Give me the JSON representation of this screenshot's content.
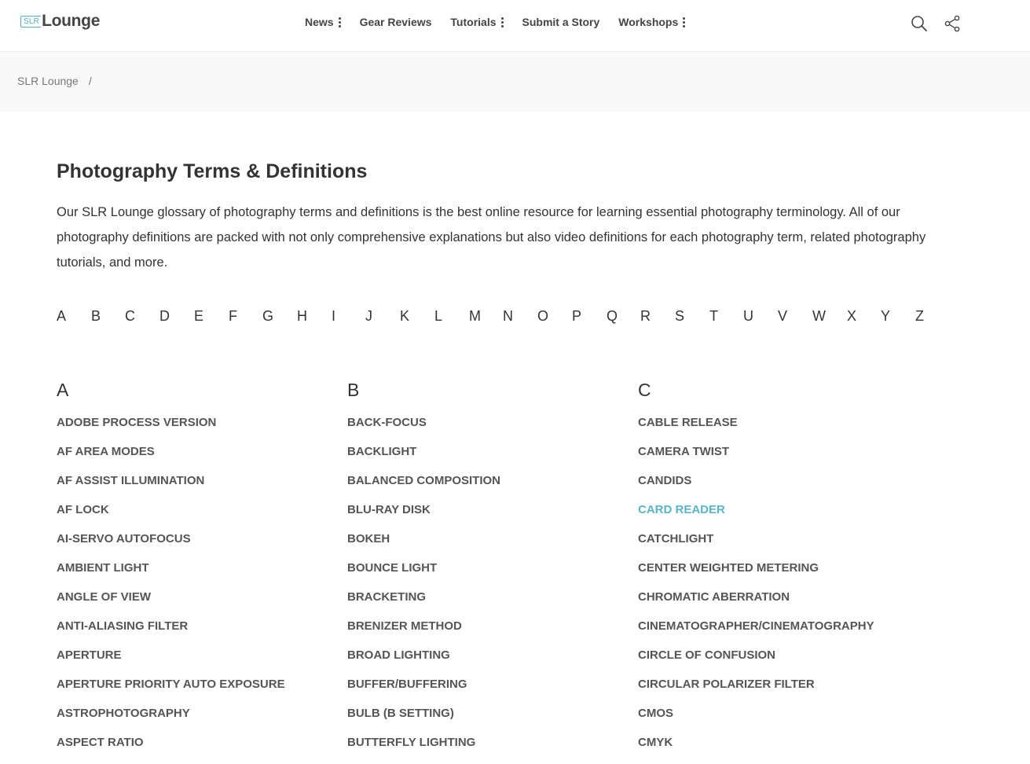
{
  "header": {
    "logo_box": "SLR",
    "logo_text": "Lounge",
    "nav": [
      {
        "label": "News",
        "has_menu": true
      },
      {
        "label": "Gear Reviews",
        "has_menu": false
      },
      {
        "label": "Tutorials",
        "has_menu": true
      },
      {
        "label": "Submit a Story",
        "has_menu": false
      },
      {
        "label": "Workshops",
        "has_menu": true
      }
    ],
    "icons": [
      "search-icon",
      "share-icon"
    ]
  },
  "breadcrumb": {
    "home": "SLR Lounge",
    "separator": "/"
  },
  "page": {
    "title": "Photography Terms & Definitions",
    "intro": "Our SLR Lounge glossary of photography terms and definitions is the best online resource for learning essential photography terminology. All of our photography definitions are packed with not only comprehensive explanations but also video definitions for each photography term, related photography tutorials, and more."
  },
  "alphabet": [
    "A",
    "B",
    "C",
    "D",
    "E",
    "F",
    "G",
    "H",
    "I",
    "J",
    "K",
    "L",
    "M",
    "N",
    "O",
    "P",
    "Q",
    "R",
    "S",
    "T",
    "U",
    "V",
    "W",
    "X",
    "Y",
    "Z"
  ],
  "columns": [
    {
      "letter": "A",
      "terms": [
        "ADOBE PROCESS VERSION",
        "AF AREA MODES",
        "AF ASSIST ILLUMINATION",
        "AF LOCK",
        "AI-SERVO AUTOFOCUS",
        "AMBIENT LIGHT",
        "ANGLE OF VIEW",
        "ANTI-ALIASING FILTER",
        "APERTURE",
        "APERTURE PRIORITY AUTO EXPOSURE",
        "ASTROPHOTOGRAPHY",
        "ASPECT RATIO"
      ]
    },
    {
      "letter": "B",
      "terms": [
        "BACK-FOCUS",
        "BACKLIGHT",
        "BALANCED COMPOSITION",
        "BLU-RAY DISK",
        "BOKEH",
        "BOUNCE LIGHT",
        "BRACKETING",
        "BRENIZER METHOD",
        "BROAD LIGHTING",
        "BUFFER/BUFFERING",
        "BULB (B SETTING)",
        "BUTTERFLY LIGHTING"
      ]
    },
    {
      "letter": "C",
      "terms": [
        "CABLE RELEASE",
        "CAMERA TWIST",
        "CANDIDS",
        "CARD READER",
        "CATCHLIGHT",
        "CENTER WEIGHTED METERING",
        "CHROMATIC ABERRATION",
        "CINEMATOGRAPHER/CINEMATOGRAPHY",
        "CIRCLE OF CONFUSION",
        "CIRCULAR POLARIZER FILTER",
        "CMOS",
        "CMYK"
      ]
    }
  ],
  "colors": {
    "accent": "#5ab4cc",
    "term": "#555555",
    "band": "#f9f9f9"
  },
  "highlighted_term": "CARD READER"
}
